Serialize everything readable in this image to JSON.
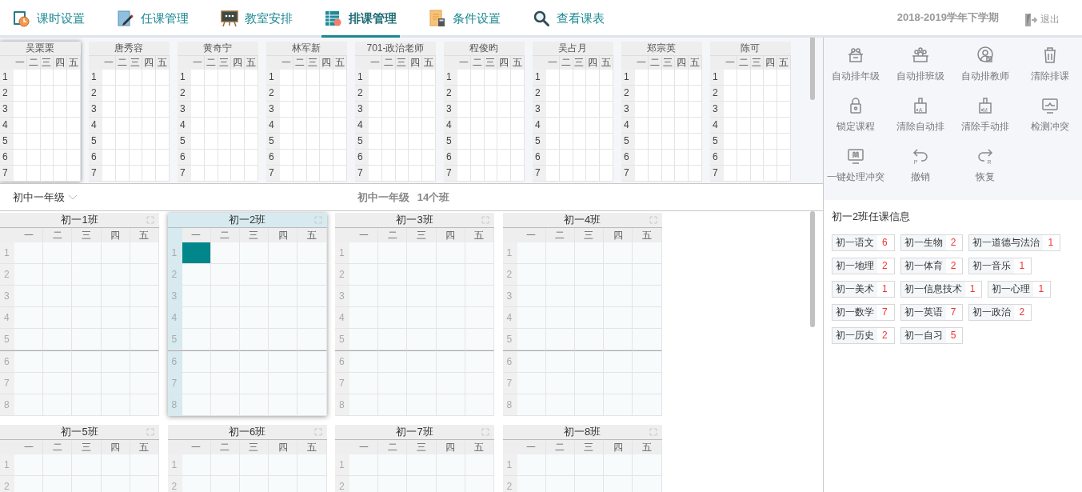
{
  "nav": {
    "tabs": [
      {
        "label": "课时设置",
        "selected": false
      },
      {
        "label": "任课管理",
        "selected": false
      },
      {
        "label": "教室安排",
        "selected": false
      },
      {
        "label": "排课管理",
        "selected": true
      },
      {
        "label": "条件设置",
        "selected": false
      },
      {
        "label": "查看课表",
        "selected": false
      }
    ],
    "term": "2018-2019学年下学期",
    "logout": "退出"
  },
  "teachers": [
    {
      "name": "吴栗栗",
      "selected": true,
      "days": [
        "一",
        "二",
        "三",
        "四",
        "五"
      ],
      "periods": [
        "1",
        "2",
        "3",
        "4",
        "5",
        "6",
        "7"
      ]
    },
    {
      "name": "唐秀容",
      "selected": false,
      "days": [
        "一",
        "二",
        "三",
        "四",
        "五"
      ],
      "periods": [
        "1",
        "2",
        "3",
        "4",
        "5",
        "6",
        "7"
      ]
    },
    {
      "name": "黄奇宁",
      "selected": false,
      "days": [
        "一",
        "二",
        "三",
        "四",
        "五"
      ],
      "periods": [
        "1",
        "2",
        "3",
        "4",
        "5",
        "6",
        "7"
      ]
    },
    {
      "name": "林军新",
      "selected": false,
      "days": [
        "一",
        "二",
        "三",
        "四",
        "五"
      ],
      "periods": [
        "1",
        "2",
        "3",
        "4",
        "5",
        "6",
        "7"
      ]
    },
    {
      "name": "701-政治老师",
      "selected": false,
      "days": [
        "一",
        "二",
        "三",
        "四",
        "五"
      ],
      "periods": [
        "1",
        "2",
        "3",
        "4",
        "5",
        "6",
        "7"
      ]
    },
    {
      "name": "程俊昀",
      "selected": false,
      "days": [
        "一",
        "二",
        "三",
        "四",
        "五"
      ],
      "periods": [
        "1",
        "2",
        "3",
        "4",
        "5",
        "6",
        "7"
      ]
    },
    {
      "name": "吴占月",
      "selected": false,
      "days": [
        "一",
        "二",
        "三",
        "四",
        "五"
      ],
      "periods": [
        "1",
        "2",
        "3",
        "4",
        "5",
        "6",
        "7"
      ]
    },
    {
      "name": "郑宗英",
      "selected": false,
      "days": [
        "一",
        "二",
        "三",
        "四",
        "五"
      ],
      "periods": [
        "1",
        "2",
        "3",
        "4",
        "5",
        "6",
        "7"
      ]
    },
    {
      "name": "陈可",
      "selected": false,
      "days": [
        "一",
        "二",
        "三",
        "四",
        "五"
      ],
      "periods": [
        "1",
        "2",
        "3",
        "4",
        "5",
        "6",
        "7"
      ]
    }
  ],
  "grade_bar": {
    "dropdown": "初中一年级",
    "title": "初中一年级",
    "class_count": "14个班"
  },
  "classes": [
    {
      "name": "初一1班",
      "selected": false,
      "days": [
        "一",
        "二",
        "三",
        "四",
        "五"
      ],
      "rows": [
        {
          "label": "1",
          "filled": [
            false,
            false,
            false,
            false,
            false
          ]
        },
        {
          "label": "2",
          "filled": [
            false,
            false,
            false,
            false,
            false
          ]
        },
        {
          "label": "3",
          "filled": [
            false,
            false,
            false,
            false,
            false
          ]
        },
        {
          "label": "4",
          "filled": [
            false,
            false,
            false,
            false,
            false
          ]
        },
        {
          "label": "5",
          "filled": [
            false,
            false,
            false,
            false,
            false
          ]
        },
        {
          "label": "6",
          "filled": [
            false,
            false,
            false,
            false,
            false
          ]
        },
        {
          "label": "7",
          "filled": [
            false,
            false,
            false,
            false,
            false
          ]
        },
        {
          "label": "8",
          "filled": [
            false,
            false,
            false,
            false,
            false
          ]
        }
      ]
    },
    {
      "name": "初一2班",
      "selected": true,
      "days": [
        "一",
        "二",
        "三",
        "四",
        "五"
      ],
      "rows": [
        {
          "label": "1",
          "filled": [
            true,
            false,
            false,
            false,
            false
          ]
        },
        {
          "label": "2",
          "filled": [
            false,
            false,
            false,
            false,
            false
          ]
        },
        {
          "label": "3",
          "filled": [
            false,
            false,
            false,
            false,
            false
          ]
        },
        {
          "label": "4",
          "filled": [
            false,
            false,
            false,
            false,
            false
          ]
        },
        {
          "label": "5",
          "filled": [
            false,
            false,
            false,
            false,
            false
          ]
        },
        {
          "label": "6",
          "filled": [
            false,
            false,
            false,
            false,
            false
          ]
        },
        {
          "label": "7",
          "filled": [
            false,
            false,
            false,
            false,
            false
          ]
        },
        {
          "label": "8",
          "filled": [
            false,
            false,
            false,
            false,
            false
          ]
        }
      ]
    },
    {
      "name": "初一3班",
      "selected": false,
      "days": [
        "一",
        "二",
        "三",
        "四",
        "五"
      ],
      "rows": [
        {
          "label": "1",
          "filled": [
            false,
            false,
            false,
            false,
            false
          ]
        },
        {
          "label": "2",
          "filled": [
            false,
            false,
            false,
            false,
            false
          ]
        },
        {
          "label": "3",
          "filled": [
            false,
            false,
            false,
            false,
            false
          ]
        },
        {
          "label": "4",
          "filled": [
            false,
            false,
            false,
            false,
            false
          ]
        },
        {
          "label": "5",
          "filled": [
            false,
            false,
            false,
            false,
            false
          ]
        },
        {
          "label": "6",
          "filled": [
            false,
            false,
            false,
            false,
            false
          ]
        },
        {
          "label": "7",
          "filled": [
            false,
            false,
            false,
            false,
            false
          ]
        },
        {
          "label": "8",
          "filled": [
            false,
            false,
            false,
            false,
            false
          ]
        }
      ]
    },
    {
      "name": "初一4班",
      "selected": false,
      "days": [
        "一",
        "二",
        "三",
        "四",
        "五"
      ],
      "rows": [
        {
          "label": "1",
          "filled": [
            false,
            false,
            false,
            false,
            false
          ]
        },
        {
          "label": "2",
          "filled": [
            false,
            false,
            false,
            false,
            false
          ]
        },
        {
          "label": "3",
          "filled": [
            false,
            false,
            false,
            false,
            false
          ]
        },
        {
          "label": "4",
          "filled": [
            false,
            false,
            false,
            false,
            false
          ]
        },
        {
          "label": "5",
          "filled": [
            false,
            false,
            false,
            false,
            false
          ]
        },
        {
          "label": "6",
          "filled": [
            false,
            false,
            false,
            false,
            false
          ]
        },
        {
          "label": "7",
          "filled": [
            false,
            false,
            false,
            false,
            false
          ]
        },
        {
          "label": "8",
          "filled": [
            false,
            false,
            false,
            false,
            false
          ]
        }
      ]
    },
    {
      "name": "初一5班",
      "selected": false,
      "days": [
        "一",
        "二",
        "三",
        "四",
        "五"
      ],
      "rows": [
        {
          "label": "1",
          "filled": [
            false,
            false,
            false,
            false,
            false
          ]
        },
        {
          "label": "2",
          "filled": [
            false,
            false,
            false,
            false,
            false
          ]
        }
      ]
    },
    {
      "name": "初一6班",
      "selected": false,
      "days": [
        "一",
        "二",
        "三",
        "四",
        "五"
      ],
      "rows": [
        {
          "label": "1",
          "filled": [
            false,
            false,
            false,
            false,
            false
          ]
        },
        {
          "label": "2",
          "filled": [
            false,
            false,
            false,
            false,
            false
          ]
        }
      ]
    },
    {
      "name": "初一7班",
      "selected": false,
      "days": [
        "一",
        "二",
        "三",
        "四",
        "五"
      ],
      "rows": [
        {
          "label": "1",
          "filled": [
            false,
            false,
            false,
            false,
            false
          ]
        },
        {
          "label": "2",
          "filled": [
            false,
            false,
            false,
            false,
            false
          ]
        }
      ]
    },
    {
      "name": "初一8班",
      "selected": false,
      "days": [
        "一",
        "二",
        "三",
        "四",
        "五"
      ],
      "rows": [
        {
          "label": "1",
          "filled": [
            false,
            false,
            false,
            false,
            false
          ]
        },
        {
          "label": "2",
          "filled": [
            false,
            false,
            false,
            false,
            false
          ]
        }
      ]
    }
  ],
  "tools": [
    {
      "label": "自动排年级"
    },
    {
      "label": "自动排班级"
    },
    {
      "label": "自动排教师"
    },
    {
      "label": "清除排课"
    },
    {
      "label": "锁定课程"
    },
    {
      "label": "清除自动排",
      "icon_letter": "A"
    },
    {
      "label": "清除手动排",
      "icon_letter": "M"
    },
    {
      "label": "检测冲突"
    },
    {
      "label": "一键处理冲突"
    },
    {
      "label": "撤销",
      "icon_letter": "P"
    },
    {
      "label": "恢复",
      "icon_letter": "R"
    }
  ],
  "info": {
    "title": "初一2班任课信息",
    "subjects": [
      {
        "name": "初一语文",
        "count": "6"
      },
      {
        "name": "初一生物",
        "count": "2"
      },
      {
        "name": "初一道德与法治",
        "count": "1"
      },
      {
        "name": "初一地理",
        "count": "2"
      },
      {
        "name": "初一体育",
        "count": "2"
      },
      {
        "name": "初一音乐",
        "count": "1"
      },
      {
        "name": "初一美术",
        "count": "1"
      },
      {
        "name": "初一信息技术",
        "count": "1"
      },
      {
        "name": "初一心理",
        "count": "1"
      },
      {
        "name": "初一数学",
        "count": "7"
      },
      {
        "name": "初一英语",
        "count": "7"
      },
      {
        "name": "初一政治",
        "count": "2"
      },
      {
        "name": "初一历史",
        "count": "2"
      },
      {
        "name": "初一自习",
        "count": "5"
      }
    ]
  }
}
